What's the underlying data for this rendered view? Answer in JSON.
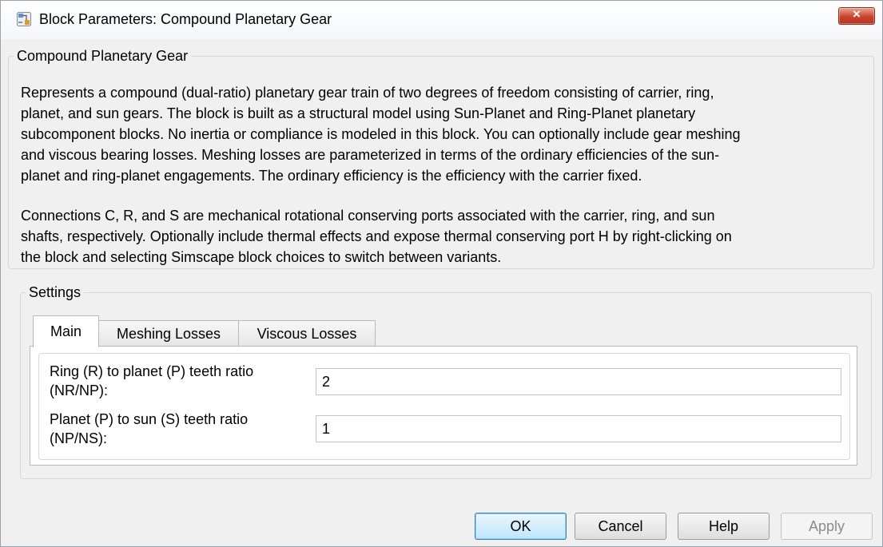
{
  "window": {
    "title": "Block Parameters: Compound Planetary Gear",
    "close_label": "×"
  },
  "description": {
    "legend": "Compound Planetary Gear",
    "paragraph1_lines": [
      "Represents a compound (dual-ratio) planetary gear train of two degrees of freedom consisting of carrier, ring,",
      "planet, and sun gears. The block is built as a structural model using Sun-Planet and Ring-Planet planetary",
      "subcomponent blocks. No inertia or compliance is modeled in this block. You can optionally include gear meshing",
      "and viscous bearing losses. Meshing losses are parameterized in terms of the ordinary efficiencies of the sun-",
      "planet and ring-planet engagements. The ordinary efficiency is the efficiency with the carrier fixed."
    ],
    "paragraph2_lines": [
      "Connections C, R, and S are mechanical rotational conserving ports associated with the carrier, ring, and sun",
      "shafts, respectively. Optionally include thermal effects and expose thermal conserving port H by right-clicking on",
      "the block and selecting Simscape block choices to switch between variants."
    ]
  },
  "settings": {
    "legend": "Settings",
    "tabs": [
      {
        "label": "Main",
        "active": true
      },
      {
        "label": "Meshing Losses",
        "active": false
      },
      {
        "label": "Viscous Losses",
        "active": false
      }
    ],
    "params": [
      {
        "label_line1": "Ring (R) to planet (P) teeth ratio",
        "label_line2": "(NR/NP):",
        "value": "2"
      },
      {
        "label_line1": "Planet (P) to sun (S) teeth ratio",
        "label_line2": "(NP/NS):",
        "value": "1"
      }
    ]
  },
  "buttons": {
    "ok": "OK",
    "cancel": "Cancel",
    "help": "Help",
    "apply": "Apply"
  },
  "colors": {
    "close_button": "#c7452d",
    "default_button": "#bee6fd",
    "dialog_background": "#f0f0f0"
  },
  "icons": [
    "simulink-block-icon",
    "close-icon"
  ]
}
